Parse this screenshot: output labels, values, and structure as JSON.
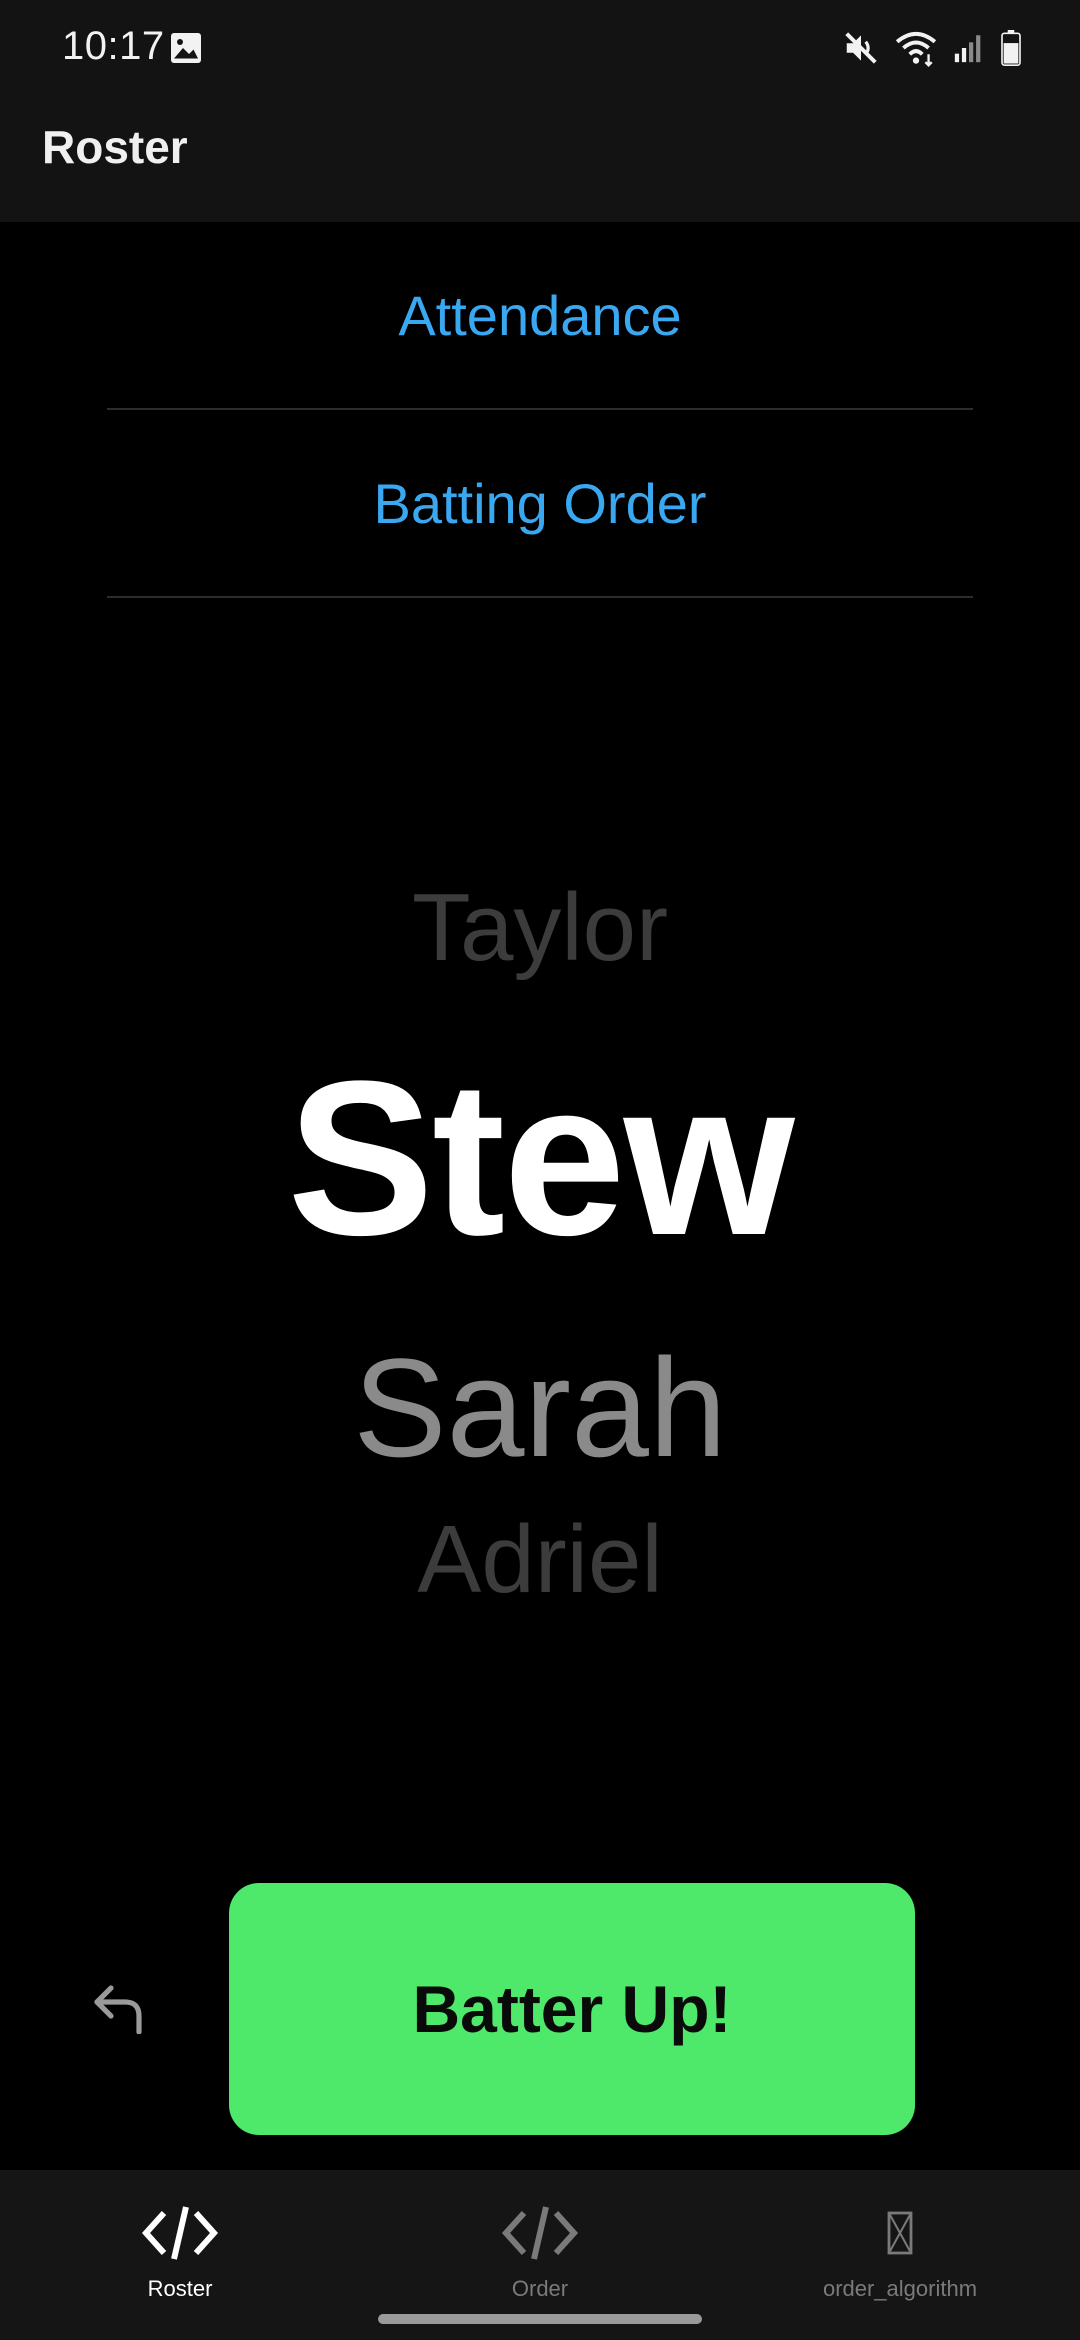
{
  "status_bar": {
    "time": "10:17",
    "icons": [
      "image-icon",
      "mute-icon",
      "wifi-icon",
      "signal-icon",
      "battery-icon"
    ]
  },
  "app_bar": {
    "title": "Roster"
  },
  "links": {
    "attendance": "Attendance",
    "batting_order": "Batting Order"
  },
  "names": {
    "previous": "Taylor",
    "current": "Stew",
    "next": "Sarah",
    "after_next": "Adriel"
  },
  "controls": {
    "undo_icon": "undo-icon",
    "batter_up_label": "Batter Up!"
  },
  "bottom_nav": {
    "items": [
      {
        "label": "Roster",
        "icon": "code-icon",
        "active": true
      },
      {
        "label": "Order",
        "icon": "code-icon",
        "active": false
      },
      {
        "label": "order_algorithm",
        "icon": "missing-glyph-icon",
        "active": false
      }
    ]
  },
  "colors": {
    "link": "#3aa8f0",
    "button_green": "#4ee86a",
    "background": "#000000",
    "bar_background": "#131313"
  }
}
